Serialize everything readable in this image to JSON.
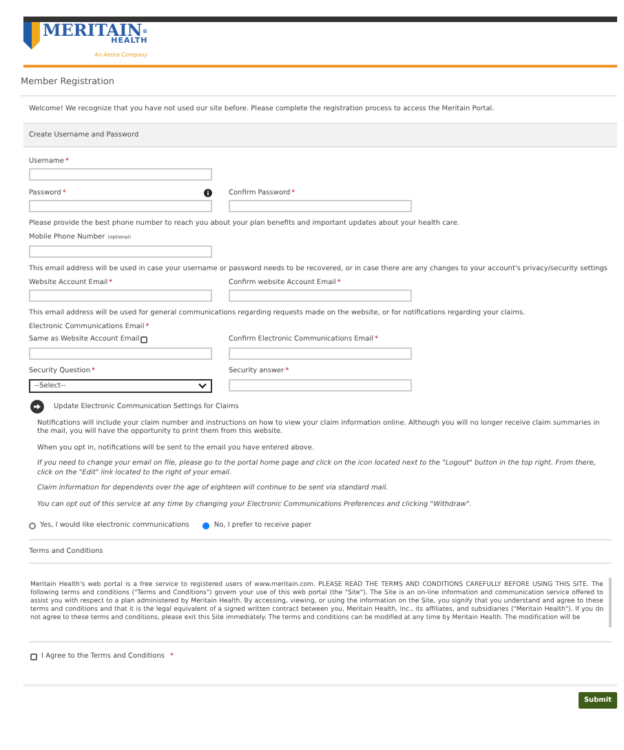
{
  "header": {
    "brand": "MERITAIN",
    "brand_mark": "®",
    "brand_sub": "HEALTH",
    "tagline": "An Aetna Company"
  },
  "page_title": "Member Registration",
  "welcome": "Welcome! We recognize that you have not used our site before. Please complete the registration process to access the Meritain Portal.",
  "section_title": "Create Username and Password",
  "form": [
    {
      "kind": "fields",
      "fields": [
        {
          "kind": "text",
          "label": "Username",
          "required_mark": "*"
        }
      ]
    },
    {
      "kind": "fields",
      "fields": [
        {
          "kind": "text",
          "label": "Password",
          "required_mark": "*",
          "info": true
        },
        {
          "kind": "text",
          "label": "Confirm Password",
          "required_mark": "*"
        }
      ]
    },
    {
      "kind": "note",
      "text": "Please provide the best phone number to reach you about your plan benefits and important updates about your health care."
    },
    {
      "kind": "fields",
      "fields": [
        {
          "kind": "text",
          "label": "Mobile Phone Number",
          "hint": "(optional)"
        }
      ]
    },
    {
      "kind": "note",
      "text": "This email address will be used in case your username or password needs to be recovered, or in case there are any changes to your account's privacy/security settings"
    },
    {
      "kind": "fields",
      "fields": [
        {
          "kind": "text",
          "label": "Website Account Email",
          "required_mark": "*"
        },
        {
          "kind": "text",
          "label": "Confirm website Account Email",
          "required_mark": "*"
        }
      ]
    },
    {
      "kind": "note",
      "text": "This email address will be used for general communications regarding requests made on the website, or for notifications regarding your claims."
    },
    {
      "kind": "label",
      "text": "Electronic Communications Email",
      "required_mark": "*"
    },
    {
      "kind": "fields",
      "fields": [
        {
          "kind": "text",
          "label": "Same as Website Account Email",
          "checkbox_checked": false
        },
        {
          "kind": "text",
          "label": "Confirm Electronic Communications Email",
          "required_mark": "*"
        }
      ]
    },
    {
      "kind": "fields",
      "fields": [
        {
          "kind": "select",
          "label": "Security Question",
          "required_mark": "*",
          "value": "--Select--"
        },
        {
          "kind": "text",
          "label": "Security answer",
          "required_mark": "*"
        }
      ]
    }
  ],
  "claims": {
    "title": "Update Electronic Communication Settings for Claims",
    "paragraphs": [
      "Notifications will include your claim number and instructions on how to view your claim information online. Although you will no longer receive claim summaries in the mail, you will have the opportunity to print them from this website.",
      "When you opt in, notifications will be sent to the email you have entered above."
    ],
    "italic_lines": [
      "If you need to change your email on file, please go to the portal home page and click on the icon located next to the \"Logout\" button in the top right. From there, click on the \"Edit\" link located to the right of your email.",
      "Claim information for dependents over the age of eighteen will continue to be sent via standard mail.",
      "You can opt out of this service at any time by changing your Electronic Communications Preferences and clicking \"Withdraw\"."
    ],
    "options": [
      {
        "label": "Yes, I would like electronic communications",
        "selected": false
      },
      {
        "label": "No, I prefer to receive paper",
        "selected": true
      }
    ]
  },
  "terms": {
    "title": "Terms and Conditions",
    "text": "Meritain Health's web portal is a free service to registered users of www.meritain.com. PLEASE READ THE TERMS AND CONDITIONS CAREFULLY BEFORE USING THIS SITE. The following terms and conditions (\"Terms and Conditions\") govern your use of this web portal (the \"Site\"). The Site is an on-line information and communication service offered to assist you with respect to a plan administered by Meritain Health. By accessing, viewing, or using the information on the Site, you signify that you understand and agree to these terms and conditions and that it is the legal equivalent of a signed written contract between you, Meritain Health, Inc., its affiliates, and subsidiaries (\"Meritain Health\"). If you do not agree to these terms and conditions, please exit this Site immediately. The terms and conditions can be modified at any time by Meritain Health. The modification will be",
    "agree": {
      "label": "I Agree to the Terms and Conditions",
      "required_mark": "*",
      "checked": false
    }
  },
  "submit": "Submit"
}
